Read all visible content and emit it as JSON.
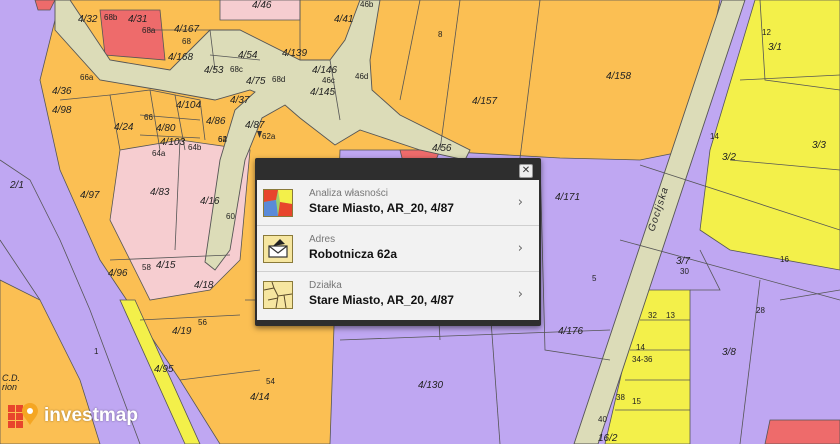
{
  "map": {
    "colors": {
      "purple": "#bfa7f2",
      "orange": "#fbbf53",
      "yellow": "#f3f04a",
      "pink": "#f6cdd0",
      "red": "#ee6b6b",
      "road": "#dcdcb8",
      "road_edge": "#5a5a5a"
    },
    "street_label": "Gocłjska",
    "parcel_labels": [
      "4/32",
      "68b",
      "4/31",
      "68a",
      "4/167",
      "68",
      "4/168",
      "4/53",
      "68c",
      "4/54",
      "4/75",
      "68d",
      "4/139",
      "4/146",
      "46c",
      "46d",
      "4/145",
      "46b",
      "4/41",
      "4/46",
      "8",
      "4/158",
      "66a",
      "4/36",
      "4/98",
      "4/24",
      "66",
      "4/104",
      "4/80",
      "4/86",
      "4/87",
      "62a",
      "4/37",
      "64",
      "4/103",
      "64b",
      "62",
      "64a",
      "4/157",
      "4/56",
      "4/171",
      "4/83",
      "4/16",
      "60",
      "4/97",
      "2/1",
      "58",
      "4/15",
      "4/96",
      "4/18",
      "56",
      "4/19",
      "1",
      "4/95",
      "54",
      "4/14",
      "4/130",
      "4/176",
      "5",
      "12",
      "3/1",
      "14",
      "3/2",
      "3/3",
      "3/7",
      "30",
      "16",
      "28",
      "3/8",
      "32",
      "13",
      "14",
      "34-36",
      "38",
      "15",
      "40",
      "16/2"
    ],
    "edge_text": "C.D.\nrion"
  },
  "popup": {
    "close_glyph": "✕",
    "rows": [
      {
        "caption": "Analiza własności",
        "value": "Stare Miasto, AR_20, 4/87",
        "icon": "ownership-map-icon"
      },
      {
        "caption": "Adres",
        "value": "Robotnicza 62a",
        "icon": "address-envelope-icon"
      },
      {
        "caption": "Działka",
        "value": "Stare Miasto, AR_20, 4/87",
        "icon": "parcel-map-icon"
      }
    ],
    "chevron": "›"
  },
  "logo": {
    "name": "investmap",
    "colors": [
      "#e8452c",
      "#f5a623"
    ]
  }
}
